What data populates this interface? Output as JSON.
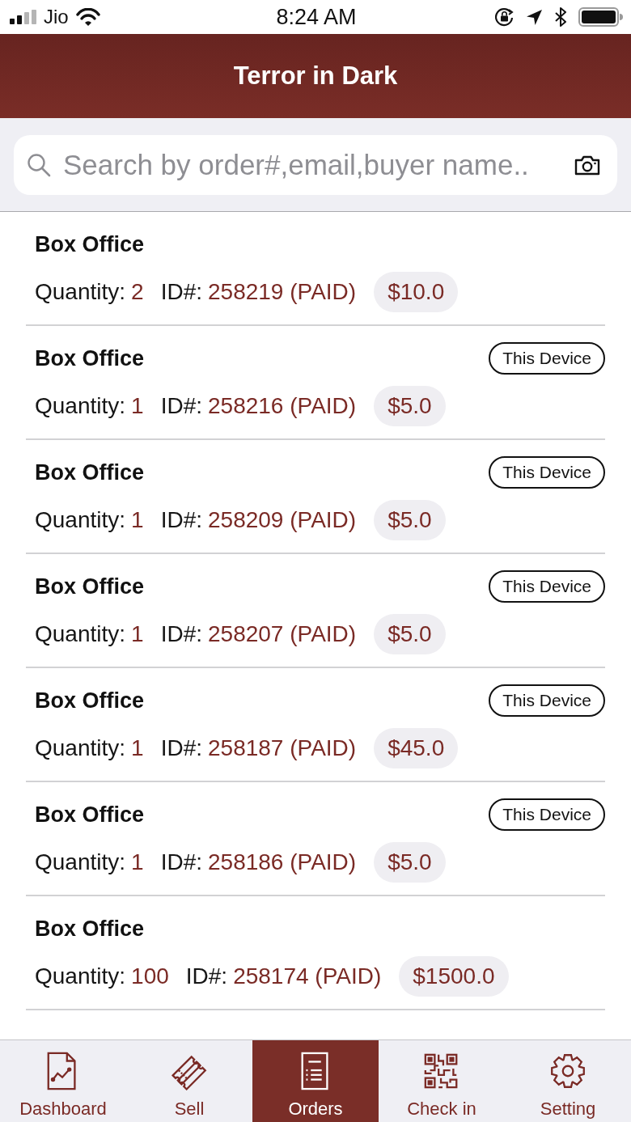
{
  "status_bar": {
    "carrier": "Jio",
    "time": "8:24 AM"
  },
  "header": {
    "title": "Terror in Dark"
  },
  "search": {
    "placeholder": "Search by order#,email,buyer name.."
  },
  "orders": [
    {
      "title": "Box Office",
      "quantity_label": "Quantity:",
      "quantity": "2",
      "id_label": "ID#:",
      "id": "258219 (PAID)",
      "price": "$10.0"
    },
    {
      "title": "Box Office",
      "badge": "This Device",
      "quantity_label": "Quantity:",
      "quantity": "1",
      "id_label": "ID#:",
      "id": "258216 (PAID)",
      "price": "$5.0"
    },
    {
      "title": "Box Office",
      "badge": "This Device",
      "quantity_label": "Quantity:",
      "quantity": "1",
      "id_label": "ID#:",
      "id": "258209 (PAID)",
      "price": "$5.0"
    },
    {
      "title": "Box Office",
      "badge": "This Device",
      "quantity_label": "Quantity:",
      "quantity": "1",
      "id_label": "ID#:",
      "id": "258207 (PAID)",
      "price": "$5.0"
    },
    {
      "title": "Box Office",
      "badge": "This Device",
      "quantity_label": "Quantity:",
      "quantity": "1",
      "id_label": "ID#:",
      "id": "258187 (PAID)",
      "price": "$45.0"
    },
    {
      "title": "Box Office",
      "badge": "This Device",
      "quantity_label": "Quantity:",
      "quantity": "1",
      "id_label": "ID#:",
      "id": "258186 (PAID)",
      "price": "$5.0"
    },
    {
      "title": "Box Office",
      "quantity_label": "Quantity:",
      "quantity": "100",
      "id_label": "ID#:",
      "id": "258174 (PAID)",
      "price": "$1500.0"
    }
  ],
  "tabs": [
    {
      "label": "Dashboard",
      "selected": false
    },
    {
      "label": "Sell",
      "selected": false
    },
    {
      "label": "Orders",
      "selected": true
    },
    {
      "label": "Check in",
      "selected": false
    },
    {
      "label": "Setting",
      "selected": false
    }
  ]
}
